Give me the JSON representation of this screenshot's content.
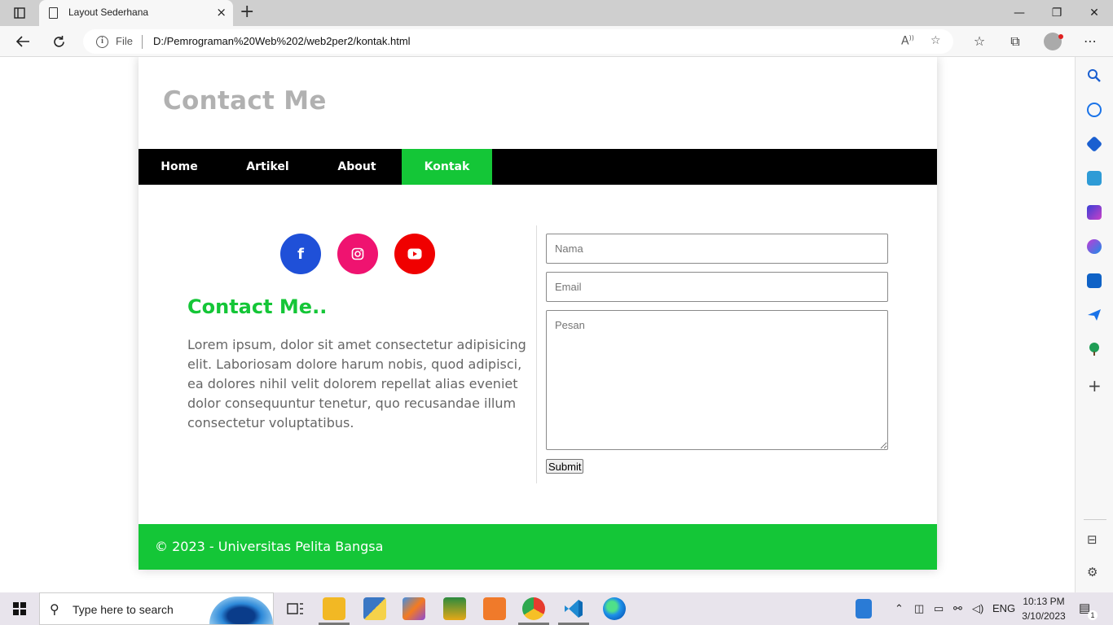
{
  "browser": {
    "tab_title": "Layout Sederhana",
    "tab_close": "×",
    "new_tab": "+",
    "file_label": "File",
    "url": "D:/Pemrograman%20Web%202/web2per2/kontak.html",
    "win_minimize": "—",
    "win_restore": "❐",
    "win_close": "✕"
  },
  "page": {
    "site_title": "Contact Me",
    "nav": [
      {
        "label": "Home",
        "active": false
      },
      {
        "label": "Artikel",
        "active": false
      },
      {
        "label": "About",
        "active": false
      },
      {
        "label": "Kontak",
        "active": true
      }
    ],
    "social": [
      {
        "icon": "facebook-icon",
        "glyph": "f",
        "color": "#1f50d8"
      },
      {
        "icon": "instagram-icon",
        "glyph": "◎",
        "color": "#ef1370"
      },
      {
        "icon": "youtube-icon",
        "glyph": "▶",
        "color": "#f00000"
      }
    ],
    "contact_heading": "Contact Me..",
    "contact_text": "Lorem ipsum, dolor sit amet consectetur adipisicing elit. Laboriosam dolore harum nobis, quod adipisci, ea dolores nihil velit dolorem repellat alias eveniet dolor consequuntur tenetur, quo recusandae illum consectetur voluptatibus.",
    "form": {
      "name_placeholder": "Nama",
      "email_placeholder": "Email",
      "message_placeholder": "Pesan",
      "submit_label": "Submit"
    },
    "footer": "© 2023 - Universitas Pelita Bangsa"
  },
  "taskbar": {
    "search_placeholder": "Type here to search",
    "language": "ENG",
    "time": "10:13 PM",
    "date": "3/10/2023",
    "notification_count": "1"
  },
  "colors": {
    "accent_green": "#14c637",
    "nav_bg": "#000000",
    "title_gray": "#b1b1b1"
  }
}
